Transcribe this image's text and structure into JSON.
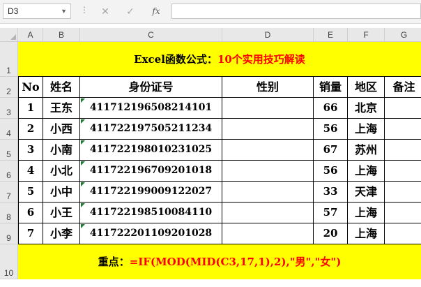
{
  "formula_bar": {
    "name_box": "D3",
    "fx_label": "fx",
    "formula": ""
  },
  "columns": [
    "A",
    "B",
    "C",
    "D",
    "E",
    "F",
    "G"
  ],
  "rows": [
    "1",
    "2",
    "3",
    "4",
    "5",
    "6",
    "7",
    "8",
    "9",
    "10"
  ],
  "title": {
    "prefix": "Excel函数公式：",
    "highlight": "10个实用技巧解读"
  },
  "headers": [
    "No",
    "姓名",
    "身份证号",
    "性别",
    "销量",
    "地区",
    "备注"
  ],
  "records": [
    {
      "no": "1",
      "name": "王东",
      "id": "411712196508214101",
      "gender": "",
      "sales": "66",
      "region": "北京",
      "note": ""
    },
    {
      "no": "2",
      "name": "小西",
      "id": "411722197505211234",
      "gender": "",
      "sales": "56",
      "region": "上海",
      "note": ""
    },
    {
      "no": "3",
      "name": "小南",
      "id": "411722198010231025",
      "gender": "",
      "sales": "67",
      "region": "苏州",
      "note": ""
    },
    {
      "no": "4",
      "name": "小北",
      "id": "411722196709201018",
      "gender": "",
      "sales": "56",
      "region": "上海",
      "note": ""
    },
    {
      "no": "5",
      "name": "小中",
      "id": "411722199009122027",
      "gender": "",
      "sales": "33",
      "region": "天津",
      "note": ""
    },
    {
      "no": "6",
      "name": "小王",
      "id": "411722198510084110",
      "gender": "",
      "sales": "57",
      "region": "上海",
      "note": ""
    },
    {
      "no": "7",
      "name": "小李",
      "id": "411722201109201028",
      "gender": "",
      "sales": "20",
      "region": "上海",
      "note": ""
    }
  ],
  "footer": {
    "label": "重点：",
    "formula": "=IF(MOD(MID(C3,17,1),2),\"男\",\"女\")"
  },
  "colors": {
    "banner": "#ffff00",
    "highlight": "#ff0000",
    "header_bg": "#e8e8e8"
  }
}
